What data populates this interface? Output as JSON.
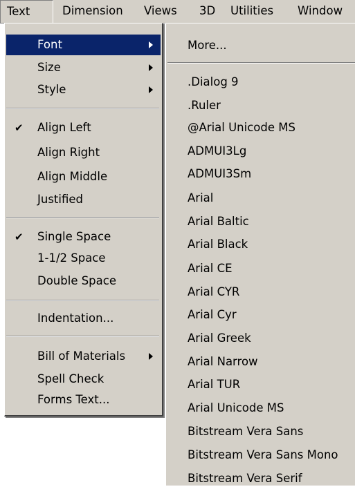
{
  "menubar": {
    "items": [
      "Text",
      "Dimension",
      "Views",
      "3D",
      "Utilities",
      "Window"
    ]
  },
  "text_menu": {
    "items": [
      {
        "label": "Font",
        "submenu": true,
        "checked": false,
        "active": true
      },
      {
        "label": "Size",
        "submenu": true,
        "checked": false
      },
      {
        "label": "Style",
        "submenu": true,
        "checked": false
      },
      {
        "label": "Align Left",
        "checked": true
      },
      {
        "label": "Align Right",
        "checked": false
      },
      {
        "label": "Align Middle",
        "checked": false
      },
      {
        "label": "Justified",
        "checked": false
      },
      {
        "label": "Single Space",
        "checked": true
      },
      {
        "label": "1-1/2 Space",
        "checked": false
      },
      {
        "label": "Double Space",
        "checked": false
      },
      {
        "label": "Indentation...",
        "checked": false
      },
      {
        "label": "Bill of Materials",
        "submenu": true,
        "checked": false
      },
      {
        "label": "Spell Check",
        "checked": false
      },
      {
        "label": "Forms Text...",
        "checked": false
      }
    ],
    "check_glyph": "✔"
  },
  "font_menu": {
    "more_label": "More...",
    "fonts": [
      ".Dialog 9",
      ".Ruler",
      "@Arial Unicode MS",
      "ADMUI3Lg",
      "ADMUI3Sm",
      "Arial",
      "Arial Baltic",
      "Arial Black",
      "Arial CE",
      "Arial CYR",
      "Arial Cyr",
      "Arial Greek",
      "Arial Narrow",
      "Arial TUR",
      "Arial Unicode MS",
      "Bitstream Vera Sans",
      "Bitstream Vera Sans Mono",
      "Bitstream Vera Serif"
    ]
  }
}
